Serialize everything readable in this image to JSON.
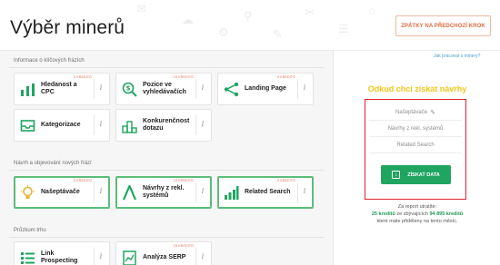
{
  "header": {
    "title": "Výběr minerů",
    "back_label": "ZPÁTKY NA PŘEDCHOZÍ KROK"
  },
  "colors": {
    "accent_green": "#1fa560",
    "accent_orange": "#e06a3c",
    "credit_red": "#e2664a",
    "prompt_yellow": "#f5c518",
    "highlight_red": "#e2232a"
  },
  "sections": [
    {
      "title": "Informace o klíčových frázích",
      "cards": [
        {
          "label": "Hledanost a CPC",
          "credit": "5 KREDITŮ",
          "icon": "bar-chart-icon",
          "selected": false
        },
        {
          "label": "Pozice ve vyhledávačích",
          "credit": "15 KREDITŮ",
          "icon": "dollar-search-icon",
          "selected": false
        },
        {
          "label": "Landing Page",
          "credit": "5 KREDITŮ",
          "icon": "share-nodes-icon",
          "selected": false
        },
        {
          "label": "Kategorizace",
          "credit": "",
          "icon": "inbox-tray-icon",
          "selected": false
        },
        {
          "label": "Konkurenčnost dotazu",
          "credit": "",
          "icon": "podium-icon",
          "selected": false
        }
      ]
    },
    {
      "title": "Návrh a objevování nových frází",
      "cards": [
        {
          "label": "Našeptávače",
          "credit": "5 KREDITŮ",
          "icon": "lightbulb-icon",
          "selected": true
        },
        {
          "label": "Návrhy z rekl. systémů",
          "credit": "15 KREDITŮ",
          "icon": "ad-letter-icon",
          "selected": true
        },
        {
          "label": "Related Search",
          "credit": "5 KREDITŮ",
          "icon": "growth-bars-icon",
          "selected": true
        }
      ]
    },
    {
      "title": "Průzkum trhu",
      "cards": [
        {
          "label": "Link Prospecting",
          "credit": "",
          "icon": "link-list-icon",
          "selected": false
        },
        {
          "label": "Analýza SERP",
          "credit": "15 KREDITŮ",
          "icon": "document-chart-icon",
          "selected": false
        }
      ]
    }
  ],
  "panel": {
    "help_link": "Jak pracovat s minery?",
    "prompt": "Odkud chci získat návrhy",
    "sources": [
      "Našeptávače",
      "Návrhy z rekl. systémů",
      "Related Search"
    ],
    "get_data_label": "ZÍSKAT DATA",
    "cost_line1": "Za report utratíte:",
    "cost_credits": "25 kreditů",
    "cost_mid": "ze zbývajících",
    "cost_remaining": "94 895 kreditů",
    "cost_line3": "které máte přiděleny na tento měsíc."
  }
}
